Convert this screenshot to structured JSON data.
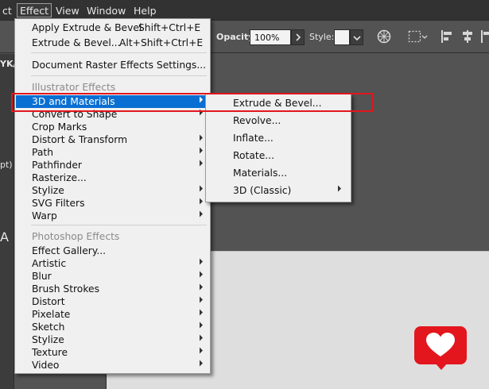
{
  "menubar": {
    "items": [
      "ct",
      "Effect",
      "View",
      "Window",
      "Help"
    ]
  },
  "controlbar": {
    "opacity_label": "Opacity:",
    "opacity_value": "100%",
    "style_label": "Style:"
  },
  "leftpanel": {
    "texts": [
      "YK/",
      "pt)",
      "A"
    ]
  },
  "effect_menu": {
    "top_items": [
      {
        "label": "Apply Extrude & Bevel",
        "shortcut": "Shift+Ctrl+E"
      },
      {
        "label": "Extrude & Bevel...",
        "shortcut": "Alt+Shift+Ctrl+E"
      }
    ],
    "doc_raster": "Document Raster Effects Settings...",
    "illustrator_header": "Illustrator Effects",
    "illustrator_items": [
      {
        "label": "3D and Materials",
        "submenu": true,
        "highlighted": true
      },
      {
        "label": "Convert to Shape",
        "submenu": true
      },
      {
        "label": "Crop Marks",
        "submenu": false
      },
      {
        "label": "Distort & Transform",
        "submenu": true
      },
      {
        "label": "Path",
        "submenu": true
      },
      {
        "label": "Pathfinder",
        "submenu": true
      },
      {
        "label": "Rasterize...",
        "submenu": false
      },
      {
        "label": "Stylize",
        "submenu": true
      },
      {
        "label": "SVG Filters",
        "submenu": true
      },
      {
        "label": "Warp",
        "submenu": true
      }
    ],
    "photoshop_header": "Photoshop Effects",
    "photoshop_items": [
      {
        "label": "Effect Gallery...",
        "submenu": false
      },
      {
        "label": "Artistic",
        "submenu": true
      },
      {
        "label": "Blur",
        "submenu": true
      },
      {
        "label": "Brush Strokes",
        "submenu": true
      },
      {
        "label": "Distort",
        "submenu": true
      },
      {
        "label": "Pixelate",
        "submenu": true
      },
      {
        "label": "Sketch",
        "submenu": true
      },
      {
        "label": "Stylize",
        "submenu": true
      },
      {
        "label": "Texture",
        "submenu": true
      },
      {
        "label": "Video",
        "submenu": true
      }
    ]
  },
  "submenu": {
    "items": [
      {
        "label": "Extrude & Bevel...",
        "submenu": false
      },
      {
        "label": "Revolve...",
        "submenu": false
      },
      {
        "label": "Inflate...",
        "submenu": false
      },
      {
        "label": "Rotate...",
        "submenu": false
      },
      {
        "label": "Materials...",
        "submenu": false
      },
      {
        "label": "3D (Classic)",
        "submenu": true
      }
    ]
  },
  "icons": {
    "submenu_arrow": "chevron-right-icon",
    "dropdown": "chevron-down-icon",
    "badge": "heart-icon"
  },
  "colors": {
    "highlight": "#0a6fd2",
    "annotation_red": "#e3151d",
    "menu_bg": "#f0f0f0"
  }
}
